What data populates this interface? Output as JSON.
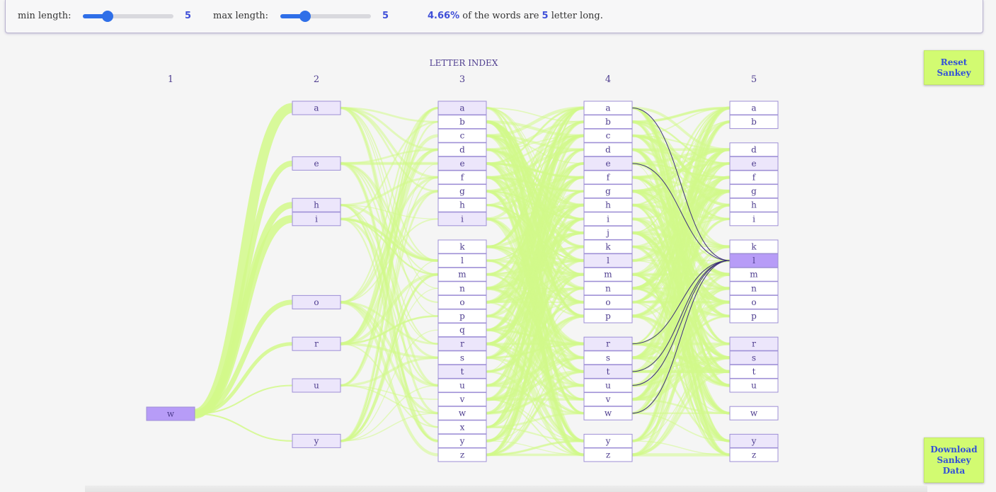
{
  "controls": {
    "min_label": "min length:",
    "min_value": "5",
    "max_label": "max length:",
    "max_value": "5",
    "summary_pct": "4.66%",
    "summary_mid": " of the words are ",
    "summary_len": "5",
    "summary_end": " letter long."
  },
  "title": "LETTER INDEX",
  "buttons": {
    "reset": "Reset Sankey",
    "download": "Download Sankey Data"
  },
  "colors": {
    "link": "#d2f98a",
    "highlight_link": "#3b2d7a",
    "node_border": "#9e8fd6",
    "node_active": "#b79cf7",
    "node_light": "#ece6fb",
    "text": "#4e3d8f"
  },
  "columns": [
    {
      "index": "1",
      "nodes": [
        "w"
      ],
      "active": [
        "w"
      ]
    },
    {
      "index": "2",
      "nodes": [
        "a",
        "e",
        "h",
        "i",
        "o",
        "r",
        "u",
        "y"
      ],
      "light": [
        "a",
        "e",
        "h",
        "i",
        "o",
        "r",
        "u",
        "y"
      ]
    },
    {
      "index": "3",
      "nodes": [
        "a",
        "b",
        "c",
        "d",
        "e",
        "f",
        "g",
        "h",
        "i",
        "k",
        "l",
        "m",
        "n",
        "o",
        "p",
        "q",
        "r",
        "s",
        "t",
        "u",
        "v",
        "w",
        "x",
        "y",
        "z"
      ],
      "light": [
        "a",
        "e",
        "i",
        "r",
        "t"
      ]
    },
    {
      "index": "4",
      "nodes": [
        "a",
        "b",
        "c",
        "d",
        "e",
        "f",
        "g",
        "h",
        "i",
        "j",
        "k",
        "l",
        "m",
        "n",
        "o",
        "p",
        "r",
        "s",
        "t",
        "u",
        "v",
        "w",
        "y",
        "z"
      ],
      "light": [
        "e",
        "r",
        "t",
        "l"
      ]
    },
    {
      "index": "5",
      "nodes": [
        "a",
        "b",
        "d",
        "e",
        "f",
        "g",
        "h",
        "i",
        "k",
        "l",
        "m",
        "n",
        "o",
        "p",
        "r",
        "s",
        "t",
        "u",
        "w",
        "y",
        "z"
      ],
      "active": [
        "l"
      ],
      "light": [
        "s",
        "e",
        "y",
        "r"
      ]
    }
  ]
}
